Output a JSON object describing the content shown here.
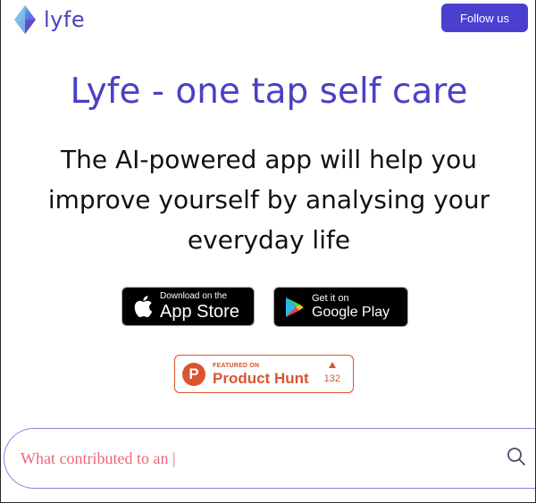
{
  "header": {
    "logo_text": "lyfe",
    "follow_label": "Follow us"
  },
  "hero": {
    "title": "Lyfe - one tap self care",
    "subtitle": "The AI-powered app will help you improve yourself by analysing your everyday life"
  },
  "badges": {
    "apple": {
      "small": "Download on the",
      "big": "App Store"
    },
    "google": {
      "small": "Get it on",
      "big": "Google Play"
    },
    "product_hunt": {
      "featured": "FEATURED ON",
      "name": "Product Hunt",
      "votes": "132",
      "letter": "P"
    }
  },
  "search": {
    "text": "What contributed to an |"
  },
  "colors": {
    "brand": "#4a41c4",
    "button": "#4b3fd0",
    "product_hunt": "#da552f",
    "search_text": "#f0647f",
    "search_border": "#8a84e0"
  },
  "icons": {
    "logo": "diamond-crystal-icon",
    "apple": "apple-icon",
    "google_play": "google-play-icon",
    "search": "search-icon"
  }
}
